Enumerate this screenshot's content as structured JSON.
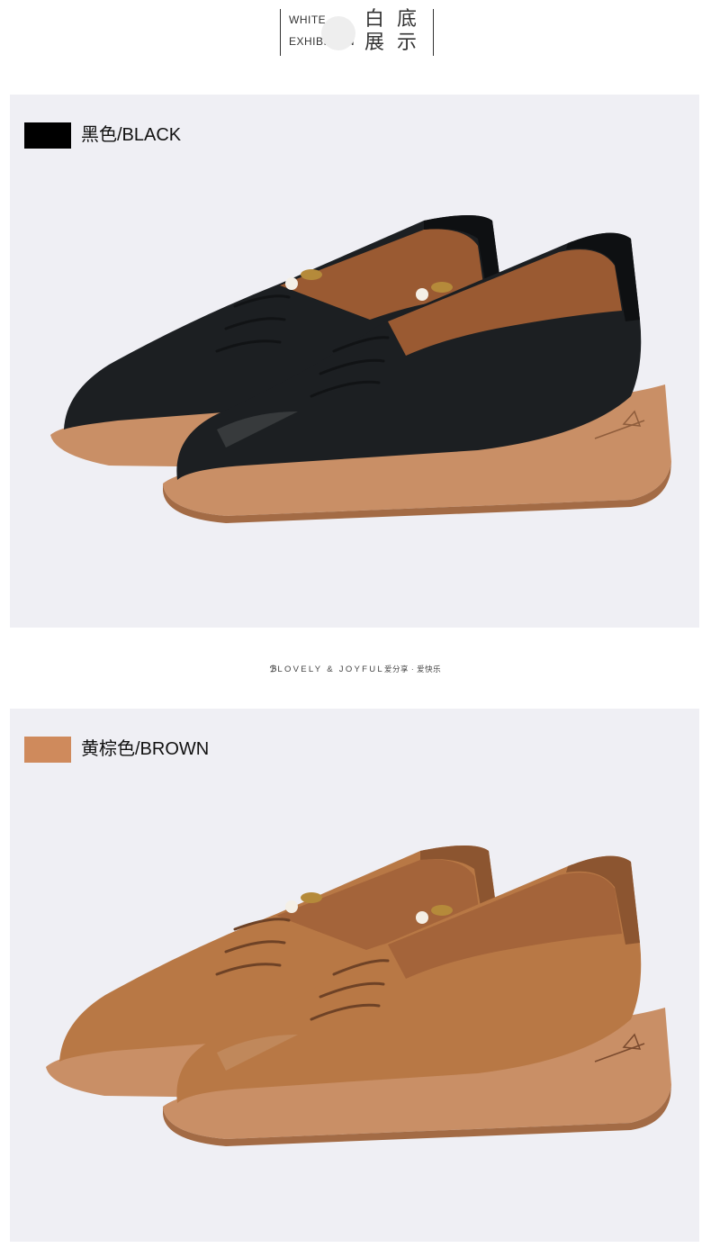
{
  "header": {
    "en_line1": "WHITE",
    "en_line2": "EXHIBITION",
    "zh_1": "白",
    "zh_2": "底",
    "zh_3": "展",
    "zh_4": "示"
  },
  "divider": {
    "mark": "ℬ",
    "text": "LOVELY & JOYFUL",
    "cn": "爱分享 · 爱快乐"
  },
  "variants": [
    {
      "label": "黑色/BLACK",
      "swatch": "#000000",
      "upper": "#1c1f22",
      "upper_shade": "#0e1012",
      "lining": "#9a5a32"
    },
    {
      "label": "黄棕色/BROWN",
      "swatch": "#cf8a5c",
      "upper": "#b87845",
      "upper_shade": "#8c5530",
      "lining": "#a4643a"
    }
  ],
  "sole_color": "#c98f66",
  "sole_edge": "#a36b45"
}
